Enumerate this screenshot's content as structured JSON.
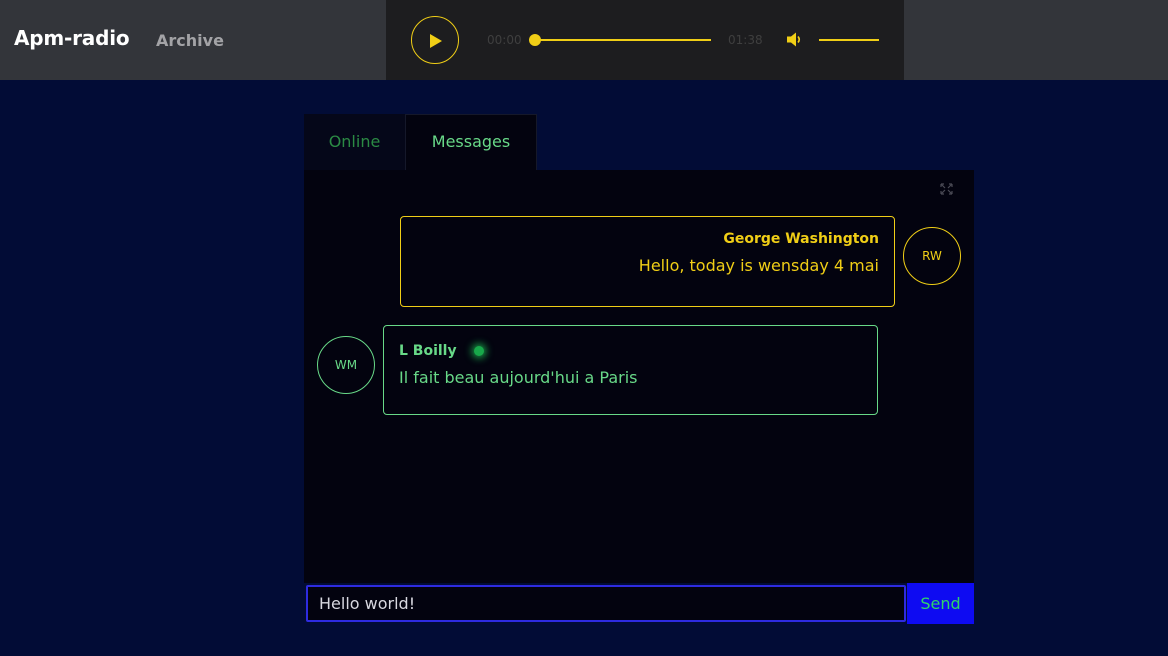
{
  "header": {
    "brand": "Apm-radio",
    "archive_link": "Archive"
  },
  "player": {
    "current_time": "00:00",
    "total_time": "01:38",
    "progress": 0,
    "volume": 1,
    "accent_color": "#f0ce16"
  },
  "tabs": [
    {
      "label": "Online",
      "active": false
    },
    {
      "label": "Messages",
      "active": true
    }
  ],
  "messages": [
    {
      "author": "George Washington",
      "text": "Hello, today is wensday 4 mai",
      "avatar": "RW",
      "color": "#f0ce16"
    },
    {
      "author": "L Boilly",
      "text": "Il fait beau aujourd'hui a Paris",
      "avatar": "WM",
      "online": true,
      "color": "#68d988"
    }
  ],
  "composer": {
    "value": "Hello world!",
    "send_label": "Send"
  },
  "colors": {
    "background": "#020c36",
    "header": "#33353a",
    "send_button": "#0e0bf2"
  }
}
